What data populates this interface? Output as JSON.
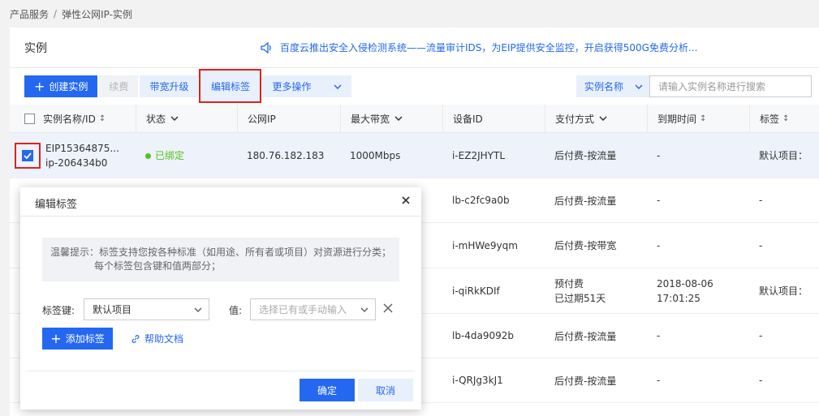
{
  "breadcrumb": {
    "item1": "产品服务",
    "separator": "/",
    "item2": "弹性公网IP-实例"
  },
  "page": {
    "title": "实例",
    "notice": "百度云推出安全入侵检测系统——流量审计IDS，为EIP提供安全监控，开启获得500G免费分析..."
  },
  "toolbar": {
    "create_label": "创建实例",
    "renew_label": "续费",
    "upgrade_label": "带宽升级",
    "edit_tag_label": "编辑标签",
    "more_label": "更多操作"
  },
  "search": {
    "field_label": "实例名称",
    "placeholder": "请输入实例名称进行搜索"
  },
  "table": {
    "headers": [
      "实例名称/ID",
      "状态",
      "公网IP",
      "最大带宽",
      "设备ID",
      "支付方式",
      "到期时间",
      "标签"
    ],
    "rows": [
      {
        "name": "EIP15364875...",
        "id": "ip-206434b0",
        "status": "已绑定",
        "ip": "180.76.182.183",
        "bandwidth": "1000Mbps",
        "device": "i-EZ2JHYTL",
        "pay": "后付费-按流量",
        "pay2": "",
        "expire": "-",
        "expire2": "",
        "tag": "默认项目："
      },
      {
        "device": "lb-c2fc9a0b",
        "pay": "后付费-按流量",
        "pay2": "",
        "expire": "-",
        "expire2": "",
        "tag": "-"
      },
      {
        "device": "i-mHWe9yqm",
        "pay": "后付费-按带宽",
        "pay2": "",
        "expire": "-",
        "expire2": "",
        "tag": "-"
      },
      {
        "device": "i-qiRkKDIf",
        "pay": "预付费",
        "pay2": "已过期51天",
        "expire": "2018-08-06",
        "expire2": "17:01:25",
        "tag": "默认项目："
      },
      {
        "device": "lb-4da9092b",
        "pay": "后付费-按流量",
        "pay2": "",
        "expire": "-",
        "expire2": "",
        "tag": "-"
      },
      {
        "device": "i-QRJg3kJ1",
        "pay": "后付费-按流量",
        "pay2": "",
        "expire": "-",
        "expire2": "",
        "tag": "-"
      }
    ]
  },
  "modal": {
    "title": "编辑标签",
    "tip_line1": "温馨提示：标签支持您按各种标准（如用途、所有者或项目）对资源进行分类；",
    "tip_line2": "每个标签包含键和值两部分；",
    "key_label": "标签键:",
    "key_value": "默认项目",
    "value_label": "值:",
    "value_placeholder": "选择已有或手动输入",
    "add_tag_label": "添加标签",
    "help_label": "帮助文档",
    "ok_label": "确定",
    "cancel_label": "取消"
  },
  "colors": {
    "primary": "#2468f2",
    "success": "#52c41a",
    "highlight": "#e02020"
  }
}
